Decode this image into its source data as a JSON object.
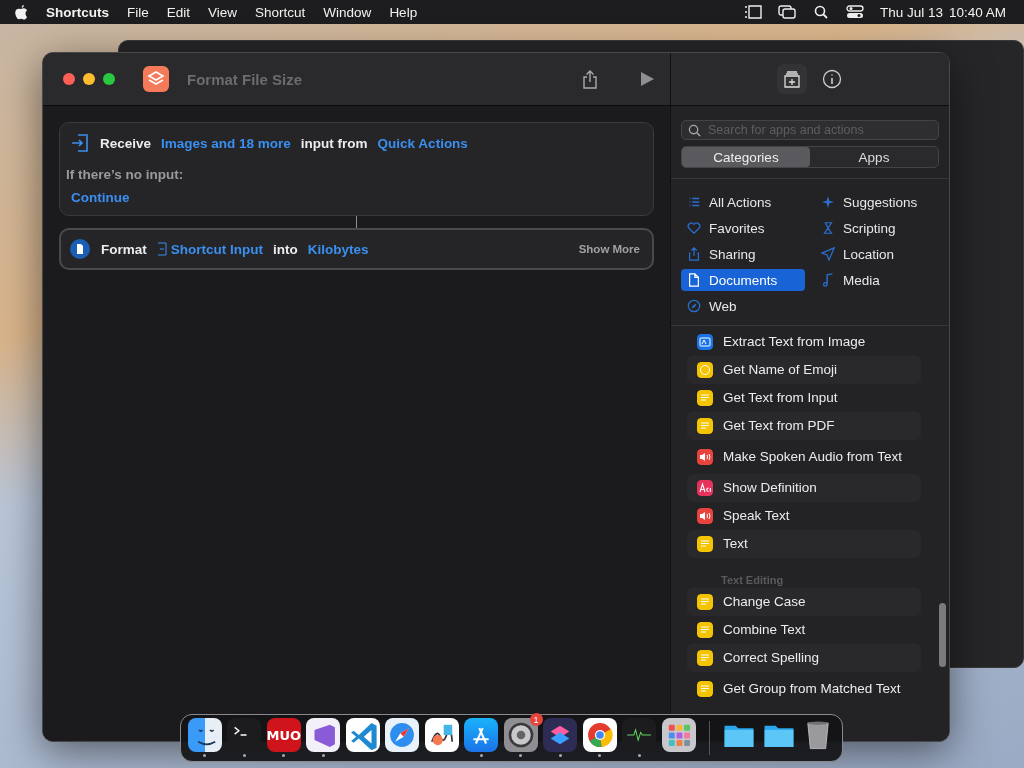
{
  "menu_bar": {
    "app_name": "Shortcuts",
    "menus": [
      "File",
      "Edit",
      "View",
      "Shortcut",
      "Window",
      "Help"
    ],
    "date": "Thu Jul 13",
    "time": "10:40 AM"
  },
  "window": {
    "title": "Format File Size"
  },
  "editor": {
    "receive": {
      "verb": "Receive",
      "types": "Images and 18 more",
      "middle": "input from",
      "source": "Quick Actions",
      "no_input_label": "If there’s no input:",
      "no_input_action": "Continue"
    },
    "format": {
      "verb": "Format",
      "input": "Shortcut Input",
      "middle": "into",
      "unit": "Kilobytes",
      "more": "Show More"
    }
  },
  "library": {
    "search": {
      "placeholder": "Search for apps and actions"
    },
    "segments": [
      {
        "label": "Categories",
        "selected": true
      },
      {
        "label": "Apps",
        "selected": false
      }
    ],
    "categories": [
      {
        "label": "All Actions",
        "kind": "list",
        "selected": false
      },
      {
        "label": "Suggestions",
        "kind": "sparkle",
        "selected": false
      },
      {
        "label": "Favorites",
        "kind": "heart",
        "selected": false
      },
      {
        "label": "Scripting",
        "kind": "script",
        "selected": false
      },
      {
        "label": "Sharing",
        "kind": "share",
        "selected": false
      },
      {
        "label": "Location",
        "kind": "location",
        "selected": false
      },
      {
        "label": "Documents",
        "kind": "document",
        "selected": true
      },
      {
        "label": "Media",
        "kind": "music",
        "selected": false
      },
      {
        "label": "Web",
        "kind": "compass",
        "selected": false
      }
    ],
    "actions": [
      {
        "label": "Extract Text from Image",
        "kind": "ocr",
        "color": "#1a73e8"
      },
      {
        "label": "Get Name of Emoji",
        "kind": "emoji",
        "color": "#f5c400"
      },
      {
        "label": "Get Text from Input",
        "kind": "text",
        "color": "#f5c400"
      },
      {
        "label": "Get Text from PDF",
        "kind": "text",
        "color": "#f5c400"
      },
      {
        "label": "Make Spoken Audio from Text",
        "kind": "speech",
        "color": "#e8433c"
      },
      {
        "label": "Show Definition",
        "kind": "dictionary",
        "color": "#e6335c"
      },
      {
        "label": "Speak Text",
        "kind": "speech",
        "color": "#e8433c"
      },
      {
        "label": "Text",
        "kind": "text",
        "color": "#f5c400"
      },
      {
        "label": "Text Editing",
        "kind": "header"
      },
      {
        "label": "Change Case",
        "kind": "text",
        "color": "#f5c400"
      },
      {
        "label": "Combine Text",
        "kind": "text",
        "color": "#f5c400"
      },
      {
        "label": "Correct Spelling",
        "kind": "text",
        "color": "#f5c400"
      },
      {
        "label": "Get Group from Matched Text",
        "kind": "text",
        "color": "#f5c400"
      }
    ]
  },
  "dock": [
    {
      "kind": "finder",
      "running": true
    },
    {
      "kind": "terminal",
      "running": true
    },
    {
      "kind": "muo",
      "label": "MUO",
      "running": true
    },
    {
      "kind": "studio",
      "running": true
    },
    {
      "kind": "vscode",
      "running": false
    },
    {
      "kind": "safari",
      "running": false
    },
    {
      "kind": "freeform",
      "running": false
    },
    {
      "kind": "appstore",
      "running": true
    },
    {
      "kind": "settings",
      "badge": "1",
      "running": true
    },
    {
      "kind": "shortcuts",
      "running": true
    },
    {
      "kind": "chrome",
      "running": true
    },
    {
      "kind": "monitor",
      "running": true
    },
    {
      "kind": "launchpad",
      "running": false
    },
    {
      "kind": "separator"
    },
    {
      "kind": "folder",
      "running": false
    },
    {
      "kind": "folder",
      "running": false
    },
    {
      "kind": "trash",
      "running": false
    }
  ]
}
